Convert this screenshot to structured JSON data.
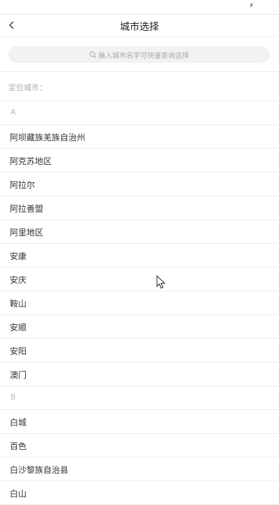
{
  "header": {
    "title": "城市选择"
  },
  "search": {
    "placeholder": "输入城市名字可快速查询选择"
  },
  "location": {
    "label": "定位城市："
  },
  "list": [
    {
      "type": "letter",
      "text": "A"
    },
    {
      "type": "city",
      "text": "阿坝藏族羌族自治州"
    },
    {
      "type": "city",
      "text": "阿克苏地区"
    },
    {
      "type": "city",
      "text": "阿拉尔"
    },
    {
      "type": "city",
      "text": "阿拉善盟"
    },
    {
      "type": "city",
      "text": "阿里地区"
    },
    {
      "type": "city",
      "text": "安康"
    },
    {
      "type": "city",
      "text": "安庆"
    },
    {
      "type": "city",
      "text": "鞍山"
    },
    {
      "type": "city",
      "text": "安顺"
    },
    {
      "type": "city",
      "text": "安阳"
    },
    {
      "type": "city",
      "text": "澳门"
    },
    {
      "type": "letter",
      "text": "B"
    },
    {
      "type": "city",
      "text": "白城"
    },
    {
      "type": "city",
      "text": "百色"
    },
    {
      "type": "city",
      "text": "白沙黎族自治县"
    },
    {
      "type": "city",
      "text": "白山"
    }
  ],
  "icons": {
    "status": "charging-bolt-icon",
    "back": "chevron-left-icon",
    "search": "search-icon",
    "cursor": "mouse-pointer-icon"
  }
}
